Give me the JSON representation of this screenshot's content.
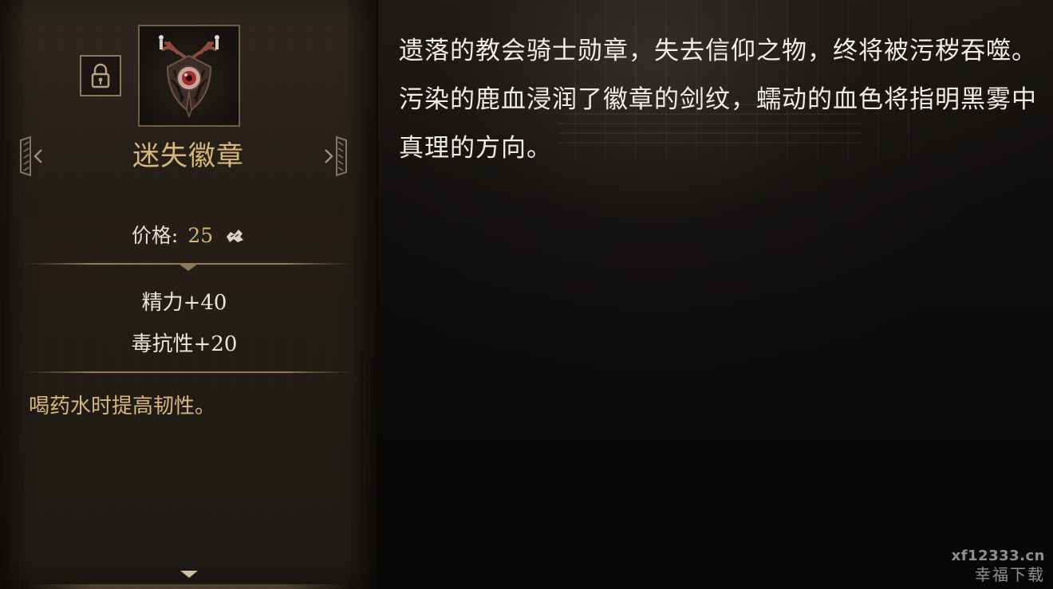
{
  "item": {
    "name": "迷失徽章",
    "price_label": "价格:",
    "price_value": "25",
    "stats": [
      "精力+40",
      "毒抗性+20"
    ],
    "effect": "喝药水时提高韧性。",
    "icon": "badge-with-antlers-and-eye-icon",
    "locked": true
  },
  "description": {
    "paragraph_1": "遗落的教会骑士勋章，失去信仰之物，终将被污秽吞噬。",
    "paragraph_2": "污染的鹿血浸润了徽章的剑纹，蠕动的血色将指明黑雾中真理的方向。"
  },
  "watermark": {
    "url": "xf12333.cn",
    "text": "幸福下载"
  },
  "colors": {
    "accent_gold": "#d6b778",
    "text_light": "#ece6da",
    "panel_bg": "#241e17",
    "frame": "#8a7a58"
  }
}
